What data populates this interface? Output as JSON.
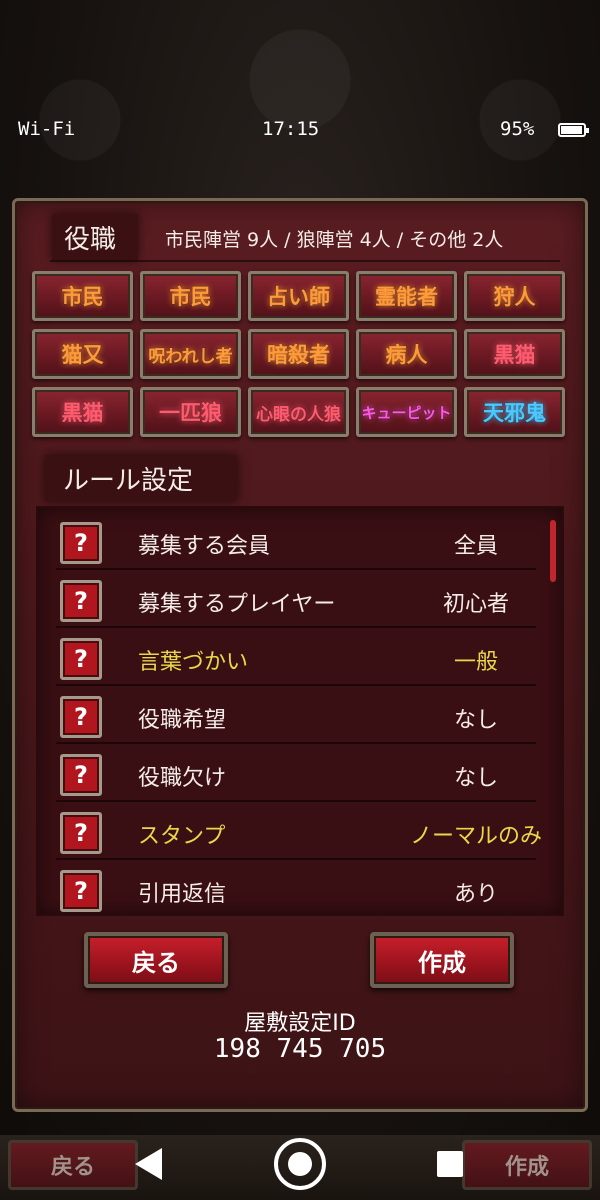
{
  "status_bar": {
    "wifi": "Wi-Fi",
    "time": "17:15",
    "battery": "95%",
    "battery_level": 0.95
  },
  "roles_section": {
    "title": "役職",
    "summary": "市民陣営 9人 / 狼陣営 4人 / その他 2人",
    "roles": [
      {
        "label": "市民",
        "color": "#ff9a3a"
      },
      {
        "label": "市民",
        "color": "#ff9a3a"
      },
      {
        "label": "占い師",
        "color": "#ff9a3a"
      },
      {
        "label": "霊能者",
        "color": "#ff9a3a"
      },
      {
        "label": "狩人",
        "color": "#ff9a3a"
      },
      {
        "label": "猫又",
        "color": "#ff9a3a"
      },
      {
        "label": "呪われし者",
        "color": "#ff9a3a"
      },
      {
        "label": "暗殺者",
        "color": "#ff9a3a"
      },
      {
        "label": "病人",
        "color": "#ff9a3a"
      },
      {
        "label": "黒猫",
        "color": "#ff5a6e"
      },
      {
        "label": "黒猫",
        "color": "#ff5a6e"
      },
      {
        "label": "一匹狼",
        "color": "#ff5a6e"
      },
      {
        "label": "心眼の人狼",
        "color": "#ff5a6e"
      },
      {
        "label": "キューピット",
        "color": "#ff5ae0"
      },
      {
        "label": "天邪鬼",
        "color": "#4ac8ff"
      }
    ]
  },
  "rules_section": {
    "title": "ルール設定",
    "help_icon": "?",
    "rules": [
      {
        "label": "募集する会員",
        "value": "全員",
        "highlight": false
      },
      {
        "label": "募集するプレイヤー",
        "value": "初心者",
        "highlight": false
      },
      {
        "label": "言葉づかい",
        "value": "一般",
        "highlight": true
      },
      {
        "label": "役職希望",
        "value": "なし",
        "highlight": false
      },
      {
        "label": "役職欠け",
        "value": "なし",
        "highlight": false
      },
      {
        "label": "スタンプ",
        "value": "ノーマルのみ",
        "highlight": true
      },
      {
        "label": "引用返信",
        "value": "あり",
        "highlight": false
      }
    ]
  },
  "actions": {
    "back": "戻る",
    "create": "作成"
  },
  "settings_id": {
    "label": "屋敷設定ID",
    "value": "198 745 705"
  },
  "background_buttons": {
    "back": "戻る",
    "create": "作成"
  },
  "nav_icons": [
    "back-triangle-icon",
    "home-circle-icon",
    "recent-square-icon"
  ]
}
